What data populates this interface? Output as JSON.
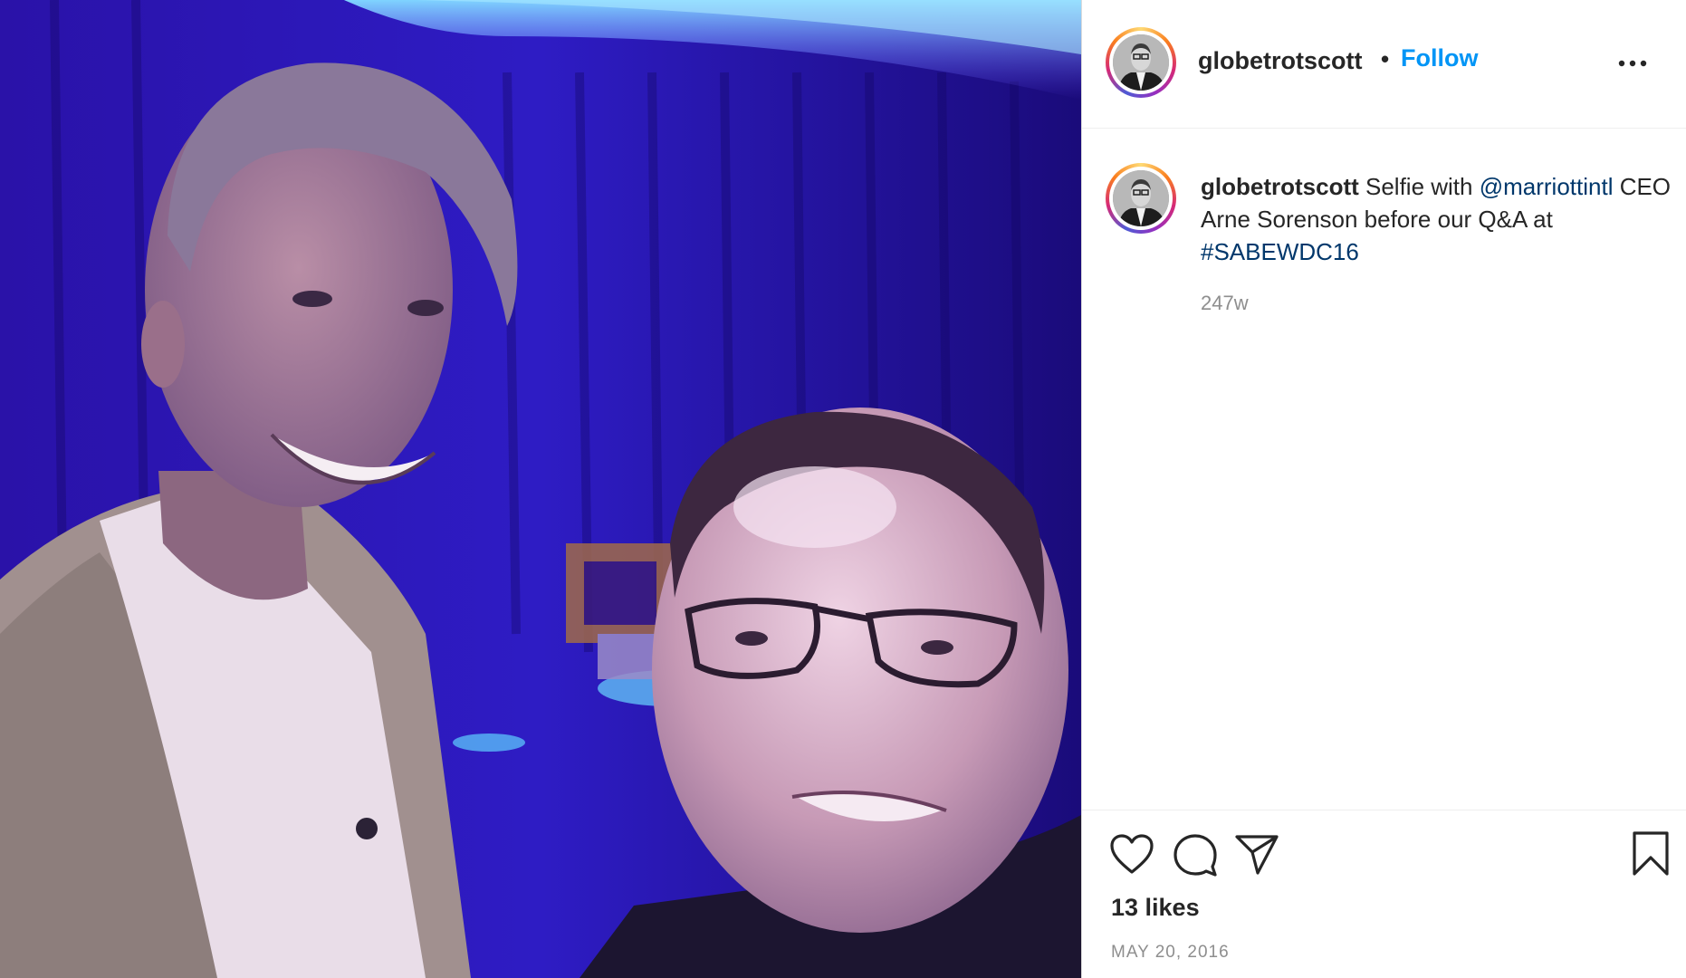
{
  "post": {
    "username": "globetrotscott",
    "separator": "•",
    "follow_label": "Follow",
    "more_icon": "more-horizontal-icon",
    "avatar_alt": "profile-avatar"
  },
  "caption": {
    "username": "globetrotscott",
    "text_1": " Selfie with ",
    "mention": "@marriottintl",
    "text_2": " CEO Arne Sorenson before our Q&A at ",
    "hashtag": "#SABEWDC16",
    "age": "247w"
  },
  "actions": {
    "like_icon": "heart-icon",
    "comment_icon": "comment-icon",
    "share_icon": "paper-plane-icon",
    "save_icon": "bookmark-icon",
    "likes": "13 likes",
    "date": "MAY 20, 2016"
  },
  "colors": {
    "follow": "#0095f6",
    "link": "#00376b",
    "text": "#262626",
    "muted": "#8e8e8e"
  }
}
